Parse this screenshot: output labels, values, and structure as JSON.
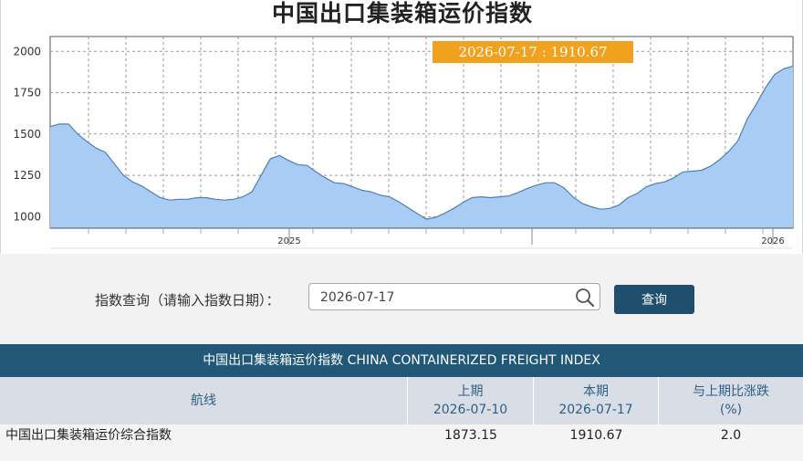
{
  "page_title": "中国出口集装箱运价指数",
  "chart_data": {
    "type": "area",
    "title": "中国出口集装箱运价指数",
    "tooltip": "2026-07-17 : 1910.67",
    "y_ticks": [
      1000,
      1250,
      1500,
      1750,
      2000
    ],
    "y_labels": [
      "1000",
      "1250",
      "1500",
      "1750",
      "2000"
    ],
    "ylim": [
      930,
      2090
    ],
    "x_labels": [
      "2025",
      "2026"
    ],
    "grid": true,
    "fill_color": "#a9ccf4",
    "line_color": "#4e80b3",
    "values": [
      1545,
      1560,
      1560,
      1500,
      1455,
      1415,
      1390,
      1320,
      1250,
      1210,
      1185,
      1150,
      1115,
      1100,
      1105,
      1105,
      1115,
      1115,
      1105,
      1100,
      1105,
      1120,
      1150,
      1250,
      1350,
      1370,
      1340,
      1315,
      1310,
      1270,
      1235,
      1205,
      1200,
      1180,
      1160,
      1150,
      1130,
      1120,
      1090,
      1055,
      1020,
      985,
      995,
      1020,
      1050,
      1085,
      1115,
      1120,
      1115,
      1120,
      1125,
      1145,
      1170,
      1190,
      1205,
      1205,
      1175,
      1120,
      1080,
      1060,
      1045,
      1050,
      1070,
      1115,
      1140,
      1180,
      1200,
      1210,
      1235,
      1270,
      1275,
      1280,
      1305,
      1345,
      1395,
      1460,
      1590,
      1680,
      1780,
      1860,
      1895,
      1911
    ]
  },
  "query": {
    "label": "指数查询（请输入指数日期）：",
    "date_value": "2026-07-17",
    "button_label": "查询"
  },
  "table": {
    "banner": "中国出口集装箱运价指数 CHINA CONTAINERIZED FREIGHT INDEX",
    "col_route": "航线",
    "col_prev": "上期",
    "col_prev_date": "2026-07-10",
    "col_curr": "本期",
    "col_curr_date": "2026-07-17",
    "col_change": "与上期比涨跌",
    "col_change_unit": "(%)",
    "rows": [
      {
        "route": "中国出口集装箱运价综合指数",
        "prev": "1873.15",
        "curr": "1910.67",
        "change": "2.0"
      }
    ]
  }
}
